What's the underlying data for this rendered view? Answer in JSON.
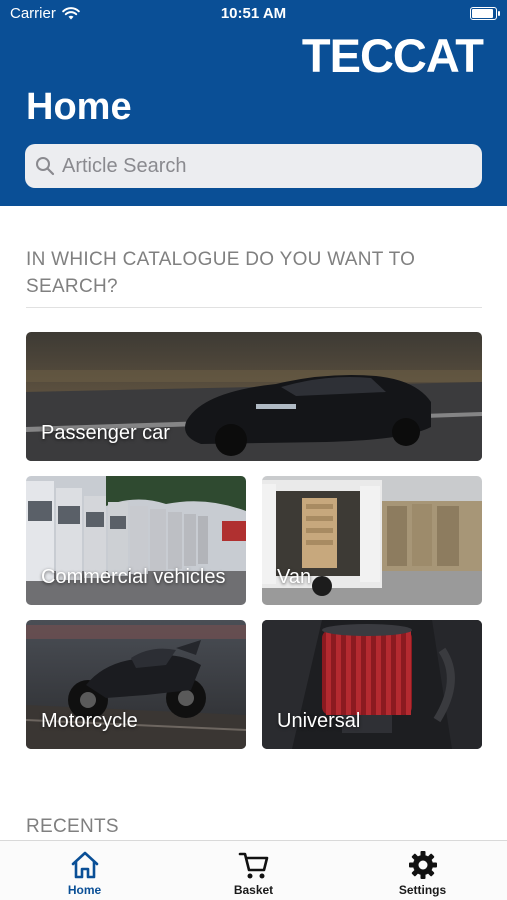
{
  "status_bar": {
    "carrier": "Carrier",
    "time": "10:51 AM"
  },
  "header": {
    "logo": "TECCAT",
    "title": "Home"
  },
  "search": {
    "placeholder": "Article Search"
  },
  "catalogue": {
    "title": "IN WHICH CATALOGUE DO YOU WANT TO SEARCH?",
    "tiles": [
      {
        "label": "Passenger car",
        "icon": "passenger-car-photo"
      },
      {
        "label": "Commercial vehicles",
        "icon": "trucks-photo"
      },
      {
        "label": "Van",
        "icon": "van-photo"
      },
      {
        "label": "Motorcycle",
        "icon": "motorcycle-photo"
      },
      {
        "label": "Universal",
        "icon": "air-filter-photo"
      }
    ]
  },
  "recents": {
    "title": "RECENTS"
  },
  "tabbar": {
    "items": [
      {
        "label": "Home",
        "icon": "home-icon",
        "active": true
      },
      {
        "label": "Basket",
        "icon": "cart-icon",
        "active": false
      },
      {
        "label": "Settings",
        "icon": "gear-icon",
        "active": false
      }
    ]
  },
  "colors": {
    "brand": "#0a4f96",
    "section_text": "#808080"
  }
}
